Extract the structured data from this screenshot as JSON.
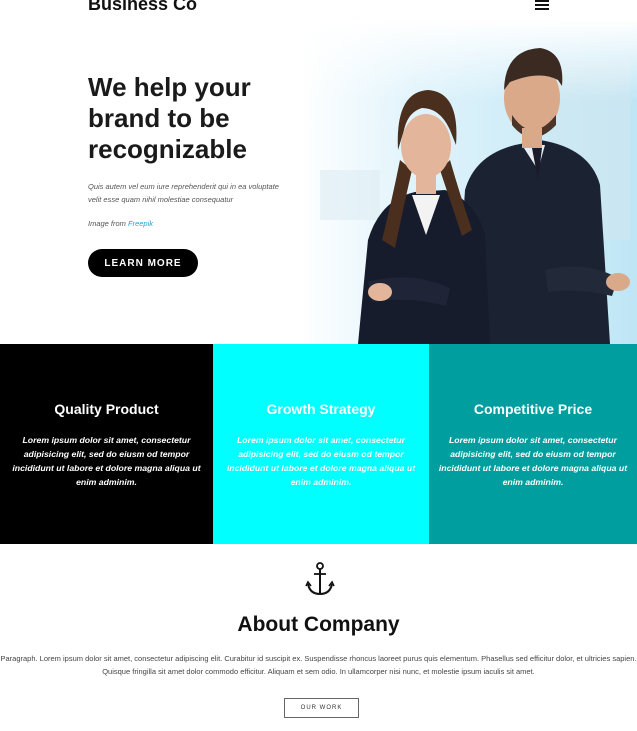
{
  "header": {
    "brand": "Business Co"
  },
  "hero": {
    "title": "We help your brand to be recognizable",
    "text": "Quis autem vel eum iure reprehenderit qui in ea voluptate velit esse quam nihil molestiae consequatur",
    "credit_prefix": "Image from ",
    "credit_link": "Freepik",
    "button_label": "LEARN MORE"
  },
  "features": [
    {
      "title": "Quality Product",
      "text": "Lorem ipsum dolor sit amet, consectetur adipisicing elit, sed do eiusm od tempor incididunt ut labore et dolore magna aliqua ut enim adminim.",
      "bg": "#000000"
    },
    {
      "title": "Growth Strategy",
      "text": "Lorem ipsum dolor sit amet, consectetur adipisicing elit, sed do eiusm od tempor incididunt ut labore et dolore magna aliqua ut enim adminim.",
      "bg": "#00ffff"
    },
    {
      "title": "Competitive Price",
      "text": "Lorem ipsum dolor sit amet, consectetur adipisicing elit, sed do eiusm od tempor incididunt ut labore et dolore magna aliqua ut enim adminim.",
      "bg": "#009e9e"
    }
  ],
  "about": {
    "icon": "anchor-icon",
    "title": "About Company",
    "text": "Paragraph. Lorem ipsum dolor sit amet, consectetur adipiscing elit. Curabitur id suscipit ex. Suspendisse rhoncus laoreet purus quis elementum. Phasellus sed efficitur dolor, et ultricies sapien. Quisque fringilla sit amet dolor commodo efficitur. Aliquam et sem odio. In ullamcorper nisi nunc, et molestie ipsum iaculis sit amet.",
    "button_label": "OUR WORK"
  }
}
